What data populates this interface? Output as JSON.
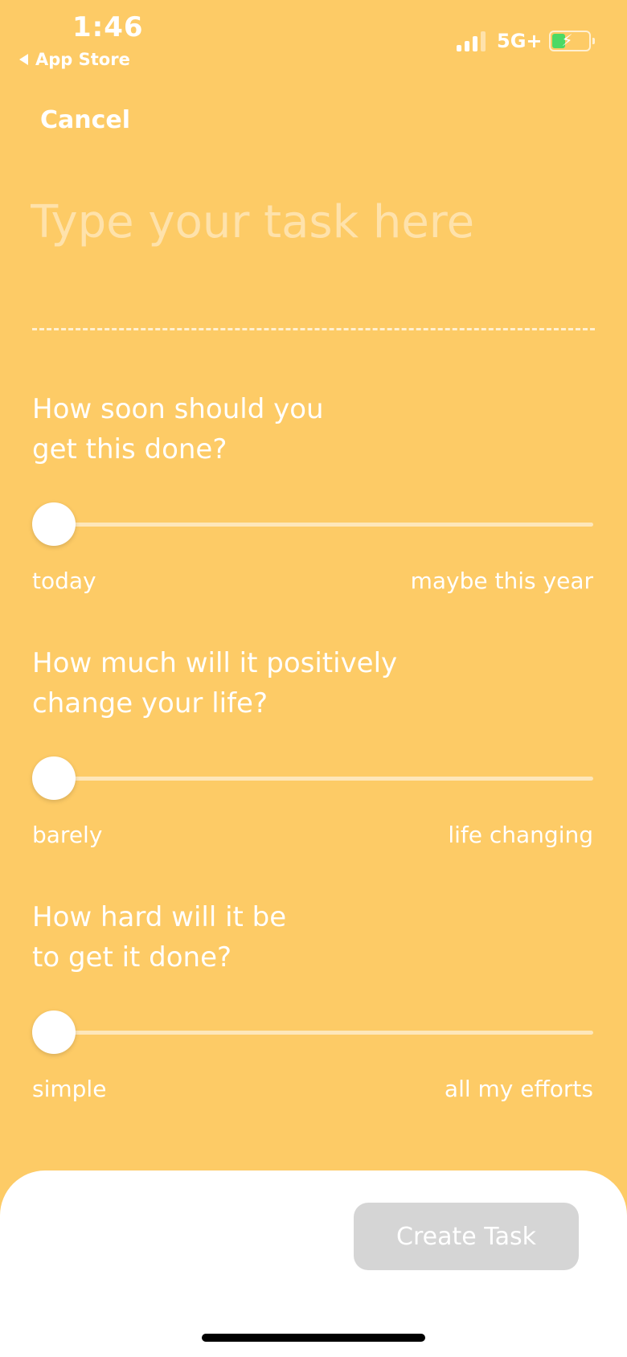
{
  "status_bar": {
    "time": "1:46",
    "back_app": "App Store",
    "network": "5G+"
  },
  "header": {
    "cancel_label": "Cancel"
  },
  "task": {
    "value": "",
    "placeholder": "Type your task here"
  },
  "questions": [
    {
      "line1": "How soon should you",
      "line2": "get this done?",
      "min_label": "today",
      "max_label": "maybe this year",
      "value": 0
    },
    {
      "line1": "How much will it positively",
      "line2": "change your life?",
      "min_label": "barely",
      "max_label": "life changing",
      "value": 0
    },
    {
      "line1": "How hard will it be",
      "line2": "to get it done?",
      "min_label": "simple",
      "max_label": "all my efforts",
      "value": 0
    }
  ],
  "footer": {
    "create_label": "Create Task"
  },
  "colors": {
    "background": "#FDCB66",
    "button_disabled": "#D5D5D5",
    "battery": "#4CD964"
  }
}
